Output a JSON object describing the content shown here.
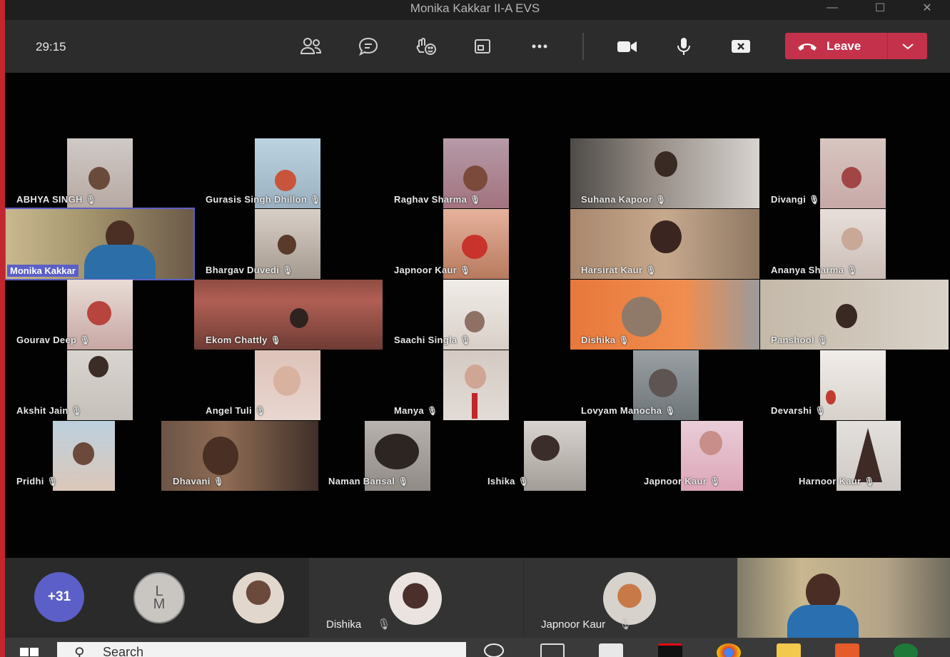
{
  "window": {
    "title": "Monika Kakkar II-A EVS",
    "minimize": "—",
    "maximize": "☐",
    "close": "✕"
  },
  "toolbar": {
    "timer": "29:15",
    "icons": [
      "participants-icon",
      "chat-icon",
      "reactions-icon",
      "share-tray-icon",
      "more-actions-icon",
      "camera-icon",
      "microphone-icon",
      "share-screen-icon"
    ],
    "leave_label": "Leave"
  },
  "participants": [
    "ABHYA SINGH",
    "Gurasis Singh Dhillon",
    "Raghav Sharma",
    "Suhana Kapoor",
    "Divangi",
    "Monika Kakkar",
    "Bhargav Duvedi",
    "Japnoor Kaur",
    "Harsirat Kaur",
    "Ananya Sharma",
    "Gourav Deep",
    "Ekom Chattly",
    "Saachi Singla",
    "Dishika",
    "Panshool",
    "Akshit Jain",
    "Angel Tuli",
    "Manya",
    "Lovyam Manocha",
    "Devarshi",
    "Pridhi",
    "Dhavani",
    "Naman Bansal",
    "Ishika",
    "Japnoor Kaur",
    "Harnoor Kaur"
  ],
  "strip": {
    "more_count": "+31",
    "initials_top": "L",
    "initials_bottom": "M",
    "names": [
      "Dishika",
      "Japnoor Kaur"
    ]
  },
  "taskbar": {
    "search_placeholder": "Search"
  },
  "colors": {
    "leave": "#c4314b",
    "more_badge": "#5b5fc7",
    "self_label": "#5b5fc7",
    "toolbar": "#2d2c2c"
  }
}
